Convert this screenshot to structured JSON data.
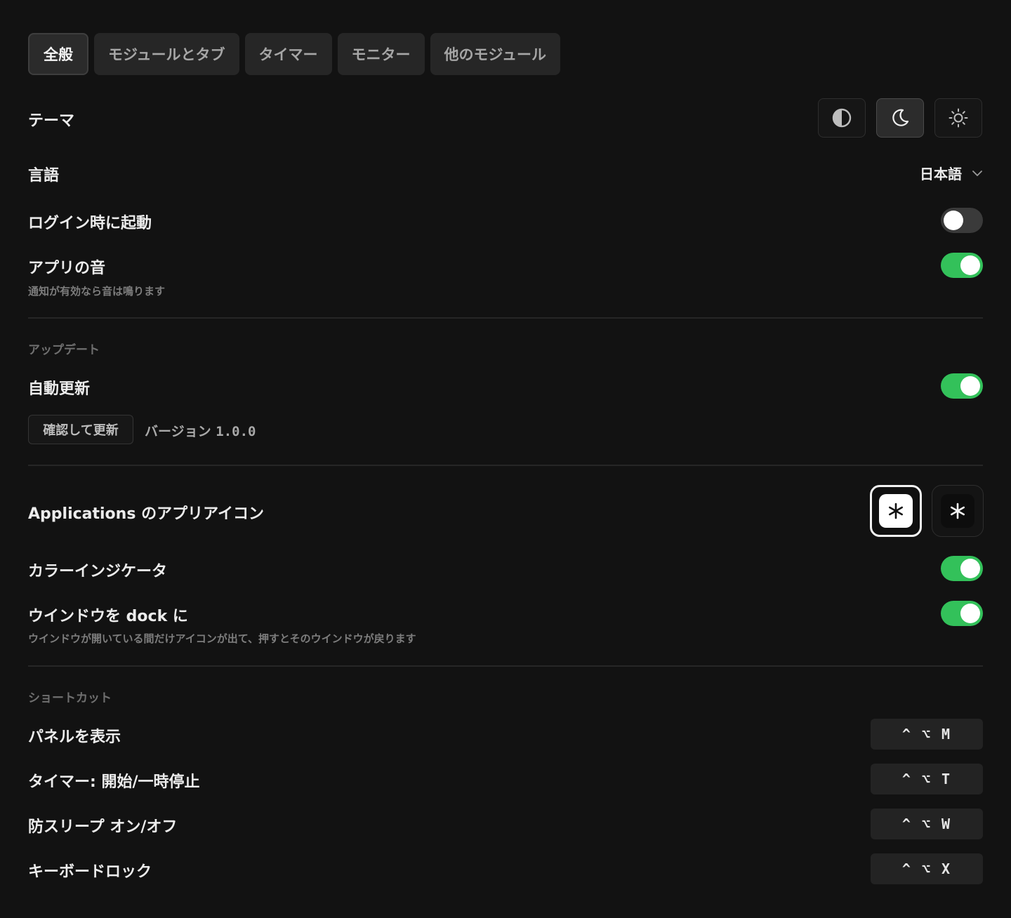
{
  "tabs": [
    {
      "label": "全般",
      "active": true
    },
    {
      "label": "モジュールとタブ",
      "active": false
    },
    {
      "label": "タイマー",
      "active": false
    },
    {
      "label": "モニター",
      "active": false
    },
    {
      "label": "他のモジュール",
      "active": false
    }
  ],
  "theme": {
    "label": "テーマ",
    "options": [
      {
        "icon": "contrast-icon",
        "active": false
      },
      {
        "icon": "moon-icon",
        "active": true
      },
      {
        "icon": "sun-icon",
        "active": false
      }
    ]
  },
  "language": {
    "label": "言語",
    "value": "日本語",
    "icon": "chevron-down-icon"
  },
  "launch_at_login": {
    "label": "ログイン時に起動",
    "enabled": false
  },
  "app_sound": {
    "label": "アプリの音",
    "description": "通知が有効なら音は鳴ります",
    "enabled": true
  },
  "updates": {
    "section_title": "アップデート",
    "auto_update_label": "自動更新",
    "auto_update_enabled": true,
    "check_button_label": "確認して更新",
    "version_label": "バージョン",
    "version_number": "1.0.0"
  },
  "app_icon": {
    "label": "Applications のアプリアイコン",
    "options": [
      {
        "icon": "asterisk-icon",
        "style": "light",
        "selected": true
      },
      {
        "icon": "asterisk-icon",
        "style": "dark",
        "selected": false
      }
    ]
  },
  "color_indicator": {
    "label": "カラーインジケータ",
    "enabled": true
  },
  "window_to_dock": {
    "label": "ウインドウを dock に",
    "description": "ウインドウが開いている間だけアイコンが出て、押すとそのウインドウが戻ります",
    "enabled": true
  },
  "shortcuts": {
    "section_title": "ショートカット",
    "items": [
      {
        "label": "パネルを表示",
        "keys": "^ ⌥ M"
      },
      {
        "label": "タイマー: 開始/一時停止",
        "keys": "^ ⌥ T"
      },
      {
        "label": "防スリープ オン/オフ",
        "keys": "^ ⌥ W"
      },
      {
        "label": "キーボードロック",
        "keys": "^ ⌥ X"
      }
    ]
  },
  "colors": {
    "background": "#121212",
    "toggle_on": "#33c15a",
    "toggle_off": "#3a3a3a"
  }
}
